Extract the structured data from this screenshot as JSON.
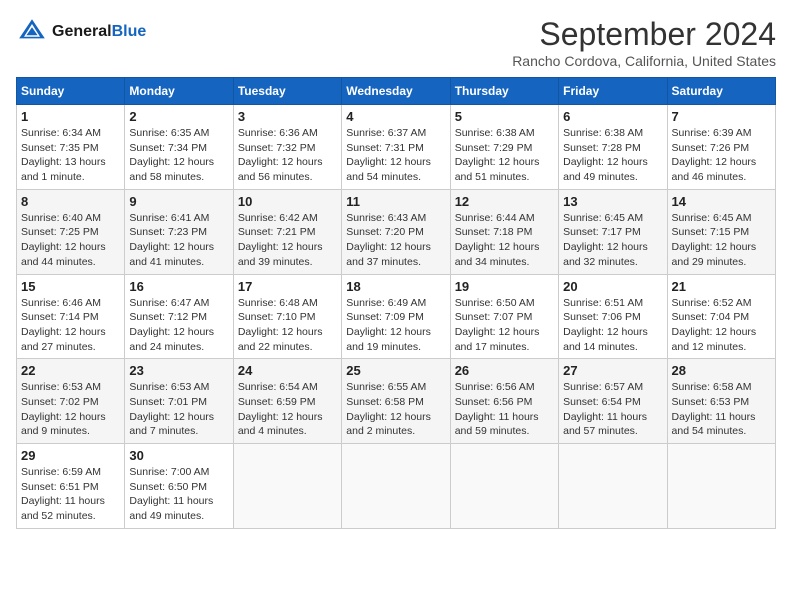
{
  "header": {
    "logo_line1": "General",
    "logo_line2": "Blue",
    "month_title": "September 2024",
    "location": "Rancho Cordova, California, United States"
  },
  "weekdays": [
    "Sunday",
    "Monday",
    "Tuesday",
    "Wednesday",
    "Thursday",
    "Friday",
    "Saturday"
  ],
  "weeks": [
    [
      {
        "day": "1",
        "info": "Sunrise: 6:34 AM\nSunset: 7:35 PM\nDaylight: 13 hours\nand 1 minute."
      },
      {
        "day": "2",
        "info": "Sunrise: 6:35 AM\nSunset: 7:34 PM\nDaylight: 12 hours\nand 58 minutes."
      },
      {
        "day": "3",
        "info": "Sunrise: 6:36 AM\nSunset: 7:32 PM\nDaylight: 12 hours\nand 56 minutes."
      },
      {
        "day": "4",
        "info": "Sunrise: 6:37 AM\nSunset: 7:31 PM\nDaylight: 12 hours\nand 54 minutes."
      },
      {
        "day": "5",
        "info": "Sunrise: 6:38 AM\nSunset: 7:29 PM\nDaylight: 12 hours\nand 51 minutes."
      },
      {
        "day": "6",
        "info": "Sunrise: 6:38 AM\nSunset: 7:28 PM\nDaylight: 12 hours\nand 49 minutes."
      },
      {
        "day": "7",
        "info": "Sunrise: 6:39 AM\nSunset: 7:26 PM\nDaylight: 12 hours\nand 46 minutes."
      }
    ],
    [
      {
        "day": "8",
        "info": "Sunrise: 6:40 AM\nSunset: 7:25 PM\nDaylight: 12 hours\nand 44 minutes."
      },
      {
        "day": "9",
        "info": "Sunrise: 6:41 AM\nSunset: 7:23 PM\nDaylight: 12 hours\nand 41 minutes."
      },
      {
        "day": "10",
        "info": "Sunrise: 6:42 AM\nSunset: 7:21 PM\nDaylight: 12 hours\nand 39 minutes."
      },
      {
        "day": "11",
        "info": "Sunrise: 6:43 AM\nSunset: 7:20 PM\nDaylight: 12 hours\nand 37 minutes."
      },
      {
        "day": "12",
        "info": "Sunrise: 6:44 AM\nSunset: 7:18 PM\nDaylight: 12 hours\nand 34 minutes."
      },
      {
        "day": "13",
        "info": "Sunrise: 6:45 AM\nSunset: 7:17 PM\nDaylight: 12 hours\nand 32 minutes."
      },
      {
        "day": "14",
        "info": "Sunrise: 6:45 AM\nSunset: 7:15 PM\nDaylight: 12 hours\nand 29 minutes."
      }
    ],
    [
      {
        "day": "15",
        "info": "Sunrise: 6:46 AM\nSunset: 7:14 PM\nDaylight: 12 hours\nand 27 minutes."
      },
      {
        "day": "16",
        "info": "Sunrise: 6:47 AM\nSunset: 7:12 PM\nDaylight: 12 hours\nand 24 minutes."
      },
      {
        "day": "17",
        "info": "Sunrise: 6:48 AM\nSunset: 7:10 PM\nDaylight: 12 hours\nand 22 minutes."
      },
      {
        "day": "18",
        "info": "Sunrise: 6:49 AM\nSunset: 7:09 PM\nDaylight: 12 hours\nand 19 minutes."
      },
      {
        "day": "19",
        "info": "Sunrise: 6:50 AM\nSunset: 7:07 PM\nDaylight: 12 hours\nand 17 minutes."
      },
      {
        "day": "20",
        "info": "Sunrise: 6:51 AM\nSunset: 7:06 PM\nDaylight: 12 hours\nand 14 minutes."
      },
      {
        "day": "21",
        "info": "Sunrise: 6:52 AM\nSunset: 7:04 PM\nDaylight: 12 hours\nand 12 minutes."
      }
    ],
    [
      {
        "day": "22",
        "info": "Sunrise: 6:53 AM\nSunset: 7:02 PM\nDaylight: 12 hours\nand 9 minutes."
      },
      {
        "day": "23",
        "info": "Sunrise: 6:53 AM\nSunset: 7:01 PM\nDaylight: 12 hours\nand 7 minutes."
      },
      {
        "day": "24",
        "info": "Sunrise: 6:54 AM\nSunset: 6:59 PM\nDaylight: 12 hours\nand 4 minutes."
      },
      {
        "day": "25",
        "info": "Sunrise: 6:55 AM\nSunset: 6:58 PM\nDaylight: 12 hours\nand 2 minutes."
      },
      {
        "day": "26",
        "info": "Sunrise: 6:56 AM\nSunset: 6:56 PM\nDaylight: 11 hours\nand 59 minutes."
      },
      {
        "day": "27",
        "info": "Sunrise: 6:57 AM\nSunset: 6:54 PM\nDaylight: 11 hours\nand 57 minutes."
      },
      {
        "day": "28",
        "info": "Sunrise: 6:58 AM\nSunset: 6:53 PM\nDaylight: 11 hours\nand 54 minutes."
      }
    ],
    [
      {
        "day": "29",
        "info": "Sunrise: 6:59 AM\nSunset: 6:51 PM\nDaylight: 11 hours\nand 52 minutes."
      },
      {
        "day": "30",
        "info": "Sunrise: 7:00 AM\nSunset: 6:50 PM\nDaylight: 11 hours\nand 49 minutes."
      },
      null,
      null,
      null,
      null,
      null
    ]
  ]
}
